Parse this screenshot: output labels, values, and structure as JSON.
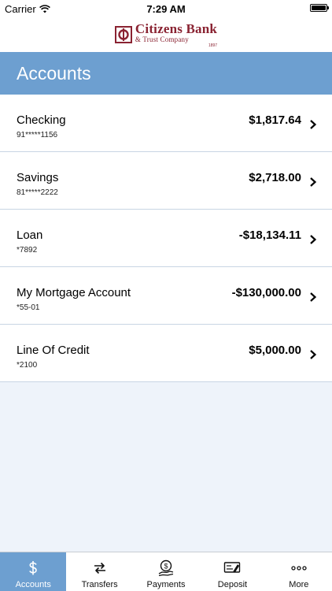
{
  "status_bar": {
    "carrier": "Carrier",
    "time": "7:29 AM"
  },
  "logo": {
    "line1": "Citizens Bank",
    "line2": "& Trust Company",
    "line3": "1897"
  },
  "header": {
    "title": "Accounts"
  },
  "accounts": [
    {
      "name": "Checking",
      "number": "91*****1156",
      "balance": "$1,817.64"
    },
    {
      "name": "Savings",
      "number": "81*****2222",
      "balance": "$2,718.00"
    },
    {
      "name": "Loan",
      "number": "*7892",
      "balance": "-$18,134.11"
    },
    {
      "name": "My Mortgage Account",
      "number": "*55-01",
      "balance": "-$130,000.00"
    },
    {
      "name": "Line Of Credit",
      "number": "*2100",
      "balance": "$5,000.00"
    }
  ],
  "tabs": [
    {
      "label": "Accounts",
      "icon": "dollar-icon",
      "active": true
    },
    {
      "label": "Transfers",
      "icon": "transfer-arrows-icon",
      "active": false
    },
    {
      "label": "Payments",
      "icon": "payments-icon",
      "active": false
    },
    {
      "label": "Deposit",
      "icon": "check-deposit-icon",
      "active": false
    },
    {
      "label": "More",
      "icon": "more-dots-icon",
      "active": false
    }
  ],
  "colors": {
    "header": "#6d9fd0",
    "brand": "#8a2332",
    "background": "#eef3fa"
  }
}
